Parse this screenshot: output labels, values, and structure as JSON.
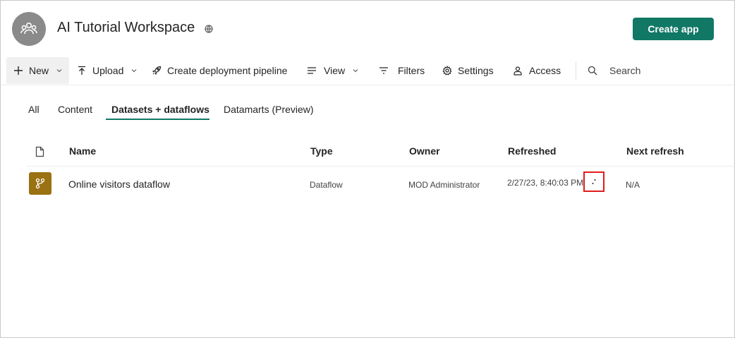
{
  "workspace": {
    "title": "AI Tutorial Workspace",
    "create_app_label": "Create app"
  },
  "toolbar": {
    "new_label": "New",
    "upload_label": "Upload",
    "pipeline_label": "Create deployment pipeline",
    "view_label": "View",
    "filters_label": "Filters",
    "settings_label": "Settings",
    "access_label": "Access",
    "search_placeholder": "Search"
  },
  "tabs": [
    {
      "label": "All"
    },
    {
      "label": "Content"
    },
    {
      "label": "Datasets + dataflows",
      "active": true
    },
    {
      "label": "Datamarts (Preview)"
    }
  ],
  "table": {
    "columns": [
      "Name",
      "Type",
      "Owner",
      "Refreshed",
      "Next refresh"
    ],
    "rows": [
      {
        "icon": "dataflow-icon",
        "name": "Online visitors dataflow",
        "type": "Dataflow",
        "owner": "MOD Administrator",
        "refreshed": "2/27/23, 8:40:03 PM",
        "next_refresh": "N/A"
      }
    ]
  },
  "colors": {
    "accent": "#117865",
    "dataflow_icon_bg": "#9a7213",
    "highlight": "#e01c1c"
  }
}
